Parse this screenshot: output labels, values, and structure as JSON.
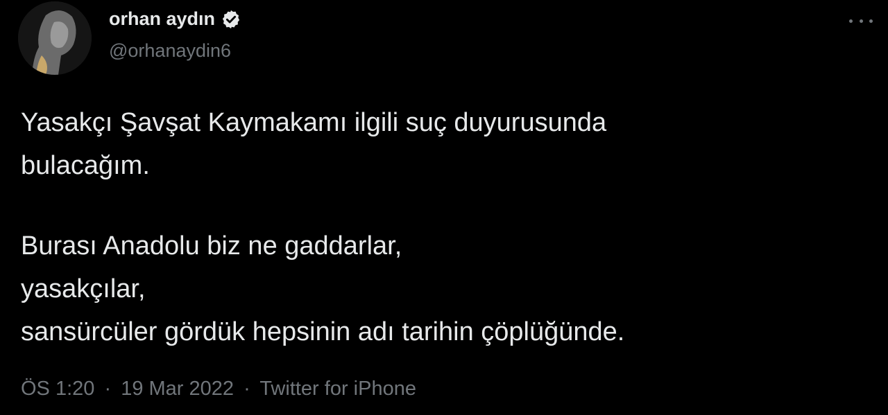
{
  "author": {
    "name": "orhan aydın",
    "handle": "@orhanaydin6",
    "verified": true
  },
  "icons": {
    "verified": "verified-badge-icon",
    "more": "more-options-icon"
  },
  "tweet": {
    "lines": [
      "Yasakçı Şavşat Kaymakamı ilgili suç duyurusunda",
      "bulacağım.",
      "",
      "Burası Anadolu biz ne gaddarlar,",
      "yasakçılar,",
      "sansürcüler gördük hepsinin adı tarihin çöplüğünde."
    ]
  },
  "meta": {
    "time": "ÖS 1:20",
    "separator": "·",
    "date": "19 Mar 2022",
    "source": "Twitter for iPhone"
  },
  "colors": {
    "background": "#000000",
    "text": "#e7e9ea",
    "secondary": "#71767b"
  }
}
